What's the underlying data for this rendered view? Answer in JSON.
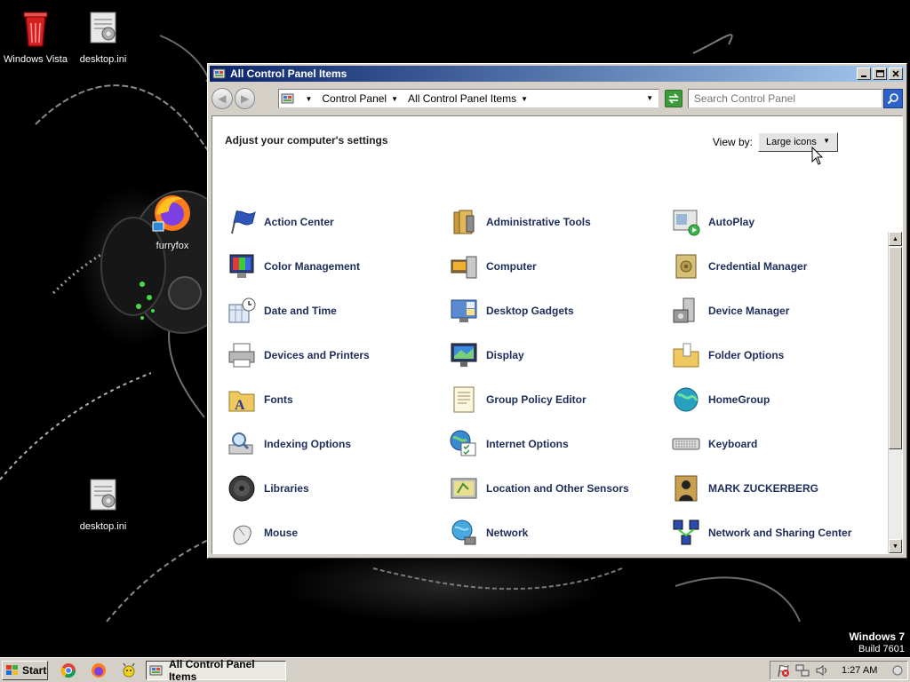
{
  "desktop": {
    "icons": [
      {
        "label": "Windows Vista",
        "icon": "recycle-bin-icon"
      },
      {
        "label": "desktop.ini",
        "icon": "settings-file-icon"
      },
      {
        "label": "furryfox",
        "icon": "firefox-icon"
      },
      {
        "label": "desktop.ini",
        "icon": "settings-file-icon"
      }
    ],
    "branding": {
      "line1": "Windows 7",
      "line2": "Build 7601"
    }
  },
  "window": {
    "title": "All Control Panel Items",
    "breadcrumbs": [
      "Control Panel",
      "All Control Panel Items"
    ],
    "search_placeholder": "Search Control Panel",
    "heading": "Adjust your computer's settings",
    "view_by_label": "View by:",
    "view_by_value": "Large icons",
    "items": [
      {
        "label": "Action Center",
        "icon": "flag-icon"
      },
      {
        "label": "Administrative Tools",
        "icon": "admin-tools-icon"
      },
      {
        "label": "AutoPlay",
        "icon": "autoplay-icon"
      },
      {
        "label": "Color Management",
        "icon": "color-management-icon"
      },
      {
        "label": "Computer",
        "icon": "computer-icon"
      },
      {
        "label": "Credential Manager",
        "icon": "vault-icon"
      },
      {
        "label": "Date and Time",
        "icon": "calendar-clock-icon"
      },
      {
        "label": "Desktop Gadgets",
        "icon": "gadgets-icon"
      },
      {
        "label": "Device Manager",
        "icon": "device-manager-icon"
      },
      {
        "label": "Devices and Printers",
        "icon": "printer-icon"
      },
      {
        "label": "Display",
        "icon": "monitor-icon"
      },
      {
        "label": "Folder Options",
        "icon": "folder-options-icon"
      },
      {
        "label": "Fonts",
        "icon": "fonts-folder-icon"
      },
      {
        "label": "Group Policy Editor",
        "icon": "policy-document-icon"
      },
      {
        "label": "HomeGroup",
        "icon": "homegroup-globe-icon"
      },
      {
        "label": "Indexing Options",
        "icon": "indexing-icon"
      },
      {
        "label": "Internet Options",
        "icon": "internet-options-icon"
      },
      {
        "label": "Keyboard",
        "icon": "keyboard-icon"
      },
      {
        "label": "Libraries",
        "icon": "libraries-icon"
      },
      {
        "label": "Location and Other Sensors",
        "icon": "sensors-icon"
      },
      {
        "label": "MARK ZUCKERBERG",
        "icon": "user-account-icon"
      },
      {
        "label": "Mouse",
        "icon": "mouse-icon"
      },
      {
        "label": "Network",
        "icon": "network-globe-icon"
      },
      {
        "label": "Network and Sharing Center",
        "icon": "network-sharing-icon"
      }
    ]
  },
  "taskbar": {
    "start_label": "Start",
    "quick_launch": [
      "chrome-icon",
      "firefox-icon",
      "misc-app-icon"
    ],
    "active_task": "All Control Panel Items",
    "tray_icons": [
      "action-center-alert-icon",
      "network-tray-icon",
      "volume-icon"
    ],
    "clock": "1:27 AM"
  },
  "colors": {
    "title_gradient_start": "#0a246a",
    "title_gradient_end": "#a6caf0",
    "item_label": "#1c2d5a",
    "chrome": "#d4d0c8"
  }
}
